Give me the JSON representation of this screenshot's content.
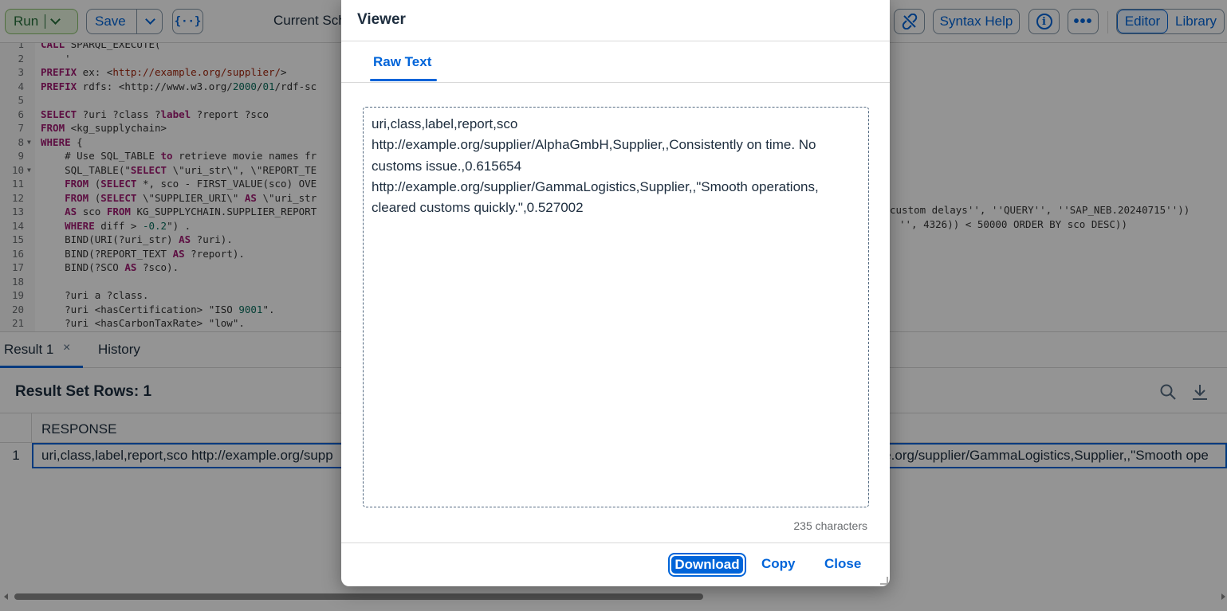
{
  "toolbar": {
    "run_label": "Run",
    "save_label": "Save",
    "braces_label": "{··}",
    "schema_label": "Current Sch",
    "syntax_help_label": "Syntax Help",
    "info_label": "i",
    "more_label": "•••",
    "editor_label": "Editor",
    "library_label": "Library",
    "accent_color": "#0064d9",
    "run_color": "#256f3a"
  },
  "editor": {
    "lines": [
      {
        "n": "1",
        "text": "CALL SPARQL_EXECUTE("
      },
      {
        "n": "2",
        "text": "    '"
      },
      {
        "n": "3",
        "text": "PREFIX ex: <http://example.org/supplier/>"
      },
      {
        "n": "4",
        "text": "PREFIX rdfs: <http://www.w3.org/2000/01/rdf-sc"
      },
      {
        "n": "5",
        "text": ""
      },
      {
        "n": "6",
        "text": "SELECT ?uri ?class ?label ?report ?sco"
      },
      {
        "n": "7",
        "text": "FROM <kg_supplychain>"
      },
      {
        "n": "8",
        "text": "WHERE {"
      },
      {
        "n": "9",
        "text": "    # Use SQL_TABLE to retrieve movie names fr"
      },
      {
        "n": "10",
        "text": "    SQL_TABLE(\"SELECT \\\"uri_str\\\", \\\"REPORT_TE"
      },
      {
        "n": "11",
        "text": "    FROM (SELECT *, sco - FIRST_VALUE(sco) OVE"
      },
      {
        "n": "12",
        "text": "    FROM (SELECT \\\"SUPPLIER_URI\\\" AS \\\"uri_str"
      },
      {
        "n": "13",
        "text": "    AS sco FROM KG_SUPPLYCHAIN.SUPPLIER_REPORT"
      },
      {
        "n": "14",
        "text": "    WHERE diff > -0.2\") ."
      },
      {
        "n": "15",
        "text": "    BIND(URI(?uri_str) AS ?uri)."
      },
      {
        "n": "16",
        "text": "    BIND(?REPORT_TEXT AS ?report)."
      },
      {
        "n": "17",
        "text": "    BIND(?SCO AS ?sco)."
      },
      {
        "n": "18",
        "text": ""
      },
      {
        "n": "19",
        "text": "    ?uri a ?class."
      },
      {
        "n": "20",
        "text": "    ?uri <hasCertification> \"ISO 9001\"."
      },
      {
        "n": "21",
        "text": "    ?uri <hasCarbonTaxRate> \"low\"."
      }
    ],
    "line12_right": "custom delays'', ''QUERY'', ''SAP_NEB.20240715''))",
    "line13_right": "'', 4326)) < 50000 ORDER BY sco DESC))"
  },
  "results": {
    "tab_result": "Result 1",
    "tab_close": "×",
    "tab_history": "History",
    "row_count": "Result Set Rows: 1",
    "column_header": "RESPONSE",
    "row_number": "1",
    "row_cell_left": "uri,class,label,report,sco  http://example.org/supp",
    "row_cell_right": "ple.org/supplier/GammaLogistics,Supplier,,\"Smooth ope"
  },
  "dialog": {
    "title": "Viewer",
    "tab_raw_text": "Raw Text",
    "raw_text": "uri,class,label,report,sco\nhttp://example.org/supplier/AlphaGmbH,Supplier,,Consistently on time. No customs issue.,0.615654\nhttp://example.org/supplier/GammaLogistics,Supplier,,\"Smooth operations, cleared customs quickly.\",0.527002",
    "char_count": "235 characters",
    "download_label": "Download",
    "copy_label": "Copy",
    "close_label": "Close"
  }
}
